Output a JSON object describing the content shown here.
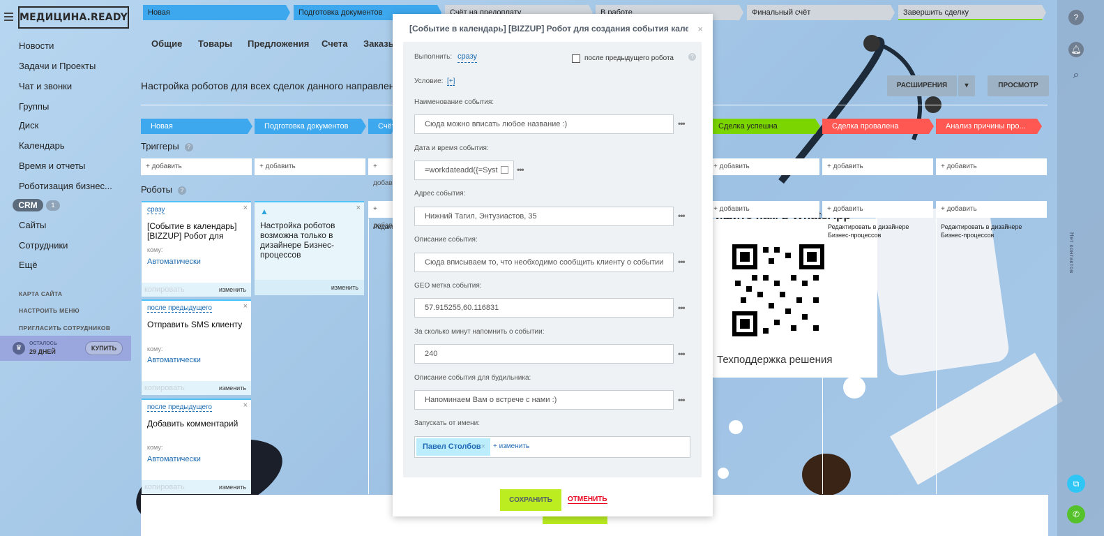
{
  "app": {
    "logo": "МЕДИЦИНА.READY"
  },
  "sidebar": {
    "items": [
      "Новости",
      "Задачи и Проекты",
      "Чат и звонки",
      "Группы",
      "Диск",
      "Календарь",
      "Время и отчеты",
      "Роботизация бизнес...",
      "CRM",
      "Сайты",
      "Сотрудники",
      "Ещё"
    ],
    "crm_count": "1",
    "small": [
      "КАРТА САЙТА",
      "НАСТРОИТЬ МЕНЮ",
      "ПРИГЛАСИТЬ СОТРУДНИКОВ"
    ],
    "promo": {
      "line1": "ОСТАЛОСЬ",
      "line2": "29 ДНЕЙ",
      "buy": "КУПИТЬ"
    }
  },
  "pipeline": [
    "Новая",
    "Подготовка документов",
    "Счёт на предоплату",
    "В работе",
    "Финальный счёт",
    "Завершить сделку"
  ],
  "tabs": [
    "Общие",
    "Товары",
    "Предложения",
    "Счета",
    "Заказы"
  ],
  "page": {
    "title": "Настройка роботов для всех сделок данного направления",
    "btn_ext": "РАСШИРЕНИЯ",
    "btn_preview": "ПРОСМОТР",
    "triggers": "Триггеры",
    "robots": "Роботы",
    "add": "+ добавить",
    "edit_in_designer": "Редактировать в дизайнере Бизнес-процессов"
  },
  "columns": [
    "Новая",
    "Подготовка документов",
    "Счёт",
    "Сделка успешна",
    "Сделка провалена",
    "Анализ причины про..."
  ],
  "robots": [
    {
      "when": "сразу",
      "name": "[Событие в календарь] [BIZZUP] Робот для",
      "who": "кому:",
      "auto": "Автоматически",
      "copy": "копировать",
      "edit": "изменить"
    },
    {
      "when": "после предыдущего",
      "name": "Отправить SMS клиенту",
      "who": "кому:",
      "auto": "Автоматически",
      "copy": "копировать",
      "edit": "изменить"
    },
    {
      "when": "после предыдущего",
      "name": "Добавить комментарий",
      "who": "кому:",
      "auto": "Автоматически",
      "copy": "копировать",
      "edit": "изменить"
    }
  ],
  "notice": {
    "text": "Настройка роботов возможна только в дизайнере Бизнес-процессов",
    "edit": "изменить"
  },
  "qr": {
    "header": "ишите нам в WhatsApp",
    "caption": "Техподдержка решения"
  },
  "right": {
    "vertical": "Нет контактов"
  },
  "modal": {
    "title": "[Событие в календарь] [BIZZUP] Робот для создания события календ...",
    "exec_label": "Выполнить:",
    "exec_value": "сразу",
    "after_prev": "после предыдущего робота",
    "cond_label": "Условие:",
    "cond_value": "[+]",
    "fields": [
      {
        "label": "Наименование события:",
        "value": "Сюда можно вписать любое название :)"
      },
      {
        "label": "Дата и время события:",
        "value": "=workdateadd({=Syst"
      },
      {
        "label": "Адрес события:",
        "value": "Нижний Тагил, Энтузиастов, 35"
      },
      {
        "label": "Описание события:",
        "value": "Сюда вписываем то, что необходимо сообщить клиенту о событии"
      },
      {
        "label": "GEO метка события:",
        "value": "57.915255,60.116831"
      },
      {
        "label": "За сколько минут напомнить о событии:",
        "value": "240"
      },
      {
        "label": "Описание события для будильника:",
        "value": "Напоминаем Вам о встрече с нами :)"
      }
    ],
    "run_as_label": "Запускать от имени:",
    "user": "Павел Столбов",
    "change": "+ изменить",
    "save": "СОХРАНИТЬ",
    "cancel": "ОТМЕНИТЬ"
  },
  "colors": {
    "stage_blue": "#3da8ee",
    "success": "#7bd500",
    "fail": "#ff5752",
    "save": "#bbed21"
  }
}
